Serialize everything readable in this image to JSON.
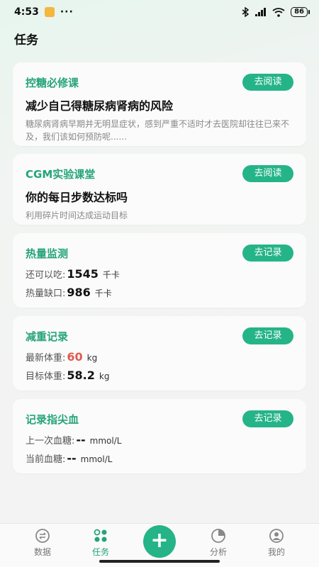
{
  "status_bar": {
    "time": "4:53",
    "dots": "···",
    "battery": "86"
  },
  "page_title": "任务",
  "cards": {
    "course1": {
      "title": "控糖必修课",
      "button": "去阅读",
      "headline": "减少自己得糖尿病肾病的风险",
      "desc": "糖尿病肾病早期并无明显症状，感到严重不适时才去医院却往往已来不及，我们该如何预防呢......"
    },
    "course2": {
      "title": "CGM实验课堂",
      "button": "去阅读",
      "headline": "你的每日步数达标吗",
      "desc": "利用碎片时间达成运动目标"
    },
    "calories": {
      "title": "热量监测",
      "button": "去记录",
      "remaining_label": "还可以吃:",
      "remaining_value": "1545",
      "remaining_unit": "千卡",
      "deficit_label": "热量缺口:",
      "deficit_value": "986",
      "deficit_unit": "千卡"
    },
    "weight": {
      "title": "减重记录",
      "button": "去记录",
      "latest_label": "最新体重:",
      "latest_value": "60",
      "latest_unit": "kg",
      "target_label": "目标体重:",
      "target_value": "58.2",
      "target_unit": "kg"
    },
    "glucose": {
      "title": "记录指尖血",
      "button": "去记录",
      "last_label": "上一次血糖:",
      "last_value": "--",
      "last_unit": "mmol/L",
      "current_label": "当前血糖:",
      "current_value": "--",
      "current_unit": "mmol/L"
    }
  },
  "tabbar": {
    "data": "数据",
    "tasks": "任务",
    "add": "+",
    "analysis": "分析",
    "mine": "我的"
  },
  "colors": {
    "accent": "#25b487",
    "accent_text": "#25a47a",
    "highlight": "#e05a4f"
  }
}
